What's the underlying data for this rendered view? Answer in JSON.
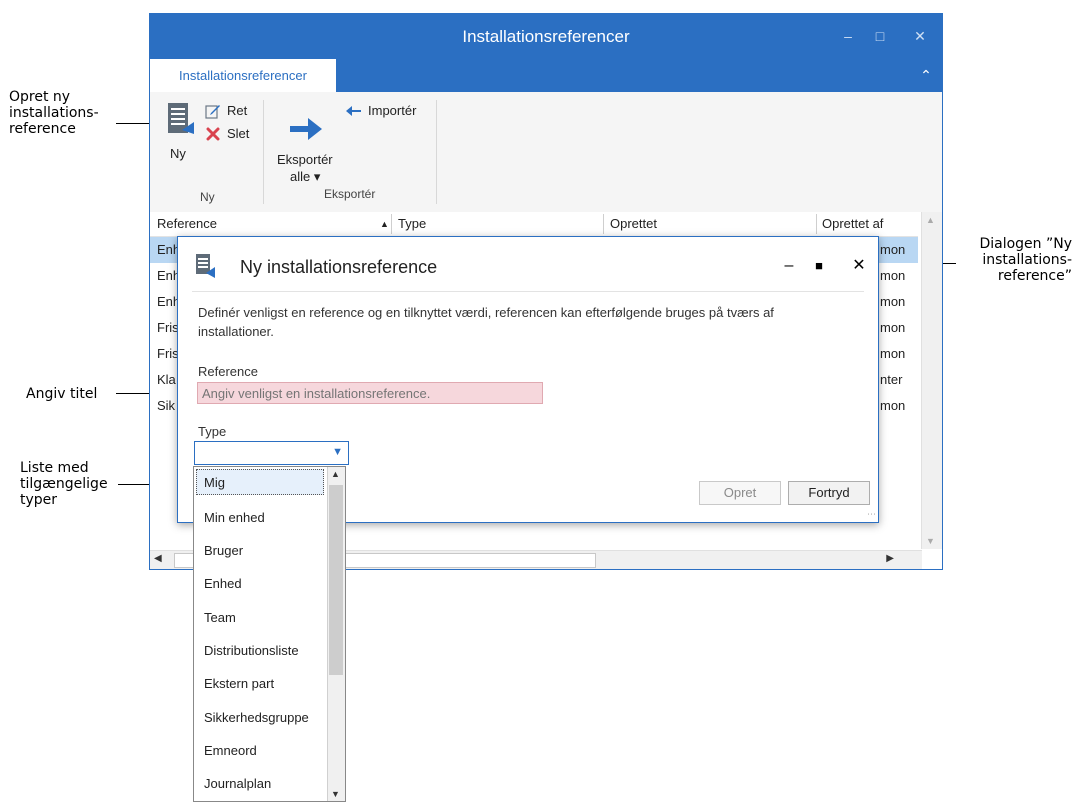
{
  "annotations": {
    "create_ref": "Opret ny installations-reference",
    "dialog_note": "Dialogen ”Ny installations-reference”",
    "title_note": "Angiv titel",
    "types_note": "Liste med tilgængelige typer"
  },
  "window": {
    "title": "Installationsreferencer",
    "minimize": "–",
    "maximize": "□",
    "close": "✕"
  },
  "ribbon": {
    "tab": "Installationsreferencer",
    "collapse": "⌃",
    "new_label": "Ny",
    "edit_label": "Ret",
    "delete_label": "Slet",
    "group_new": "Ny",
    "export_all_line1": "Eksportér",
    "export_all_line2": "alle ▾",
    "import_label": "Importér",
    "group_export": "Eksportér"
  },
  "list": {
    "columns": [
      "Reference",
      "Type",
      "Oprettet",
      "Oprettet af"
    ],
    "sort_indicator": "▲",
    "rows": [
      {
        "ref": "Enh",
        "by": "mon"
      },
      {
        "ref": "Enh",
        "by": "mon"
      },
      {
        "ref": "Enh",
        "by": "mon"
      },
      {
        "ref": "Fris",
        "by": "mon"
      },
      {
        "ref": "Fris",
        "by": "mon"
      },
      {
        "ref": "Kla",
        "by": "nter"
      },
      {
        "ref": "Sik",
        "by": "mon"
      }
    ]
  },
  "dialog": {
    "title": "Ny installationsreference",
    "minimize": "–",
    "maximize": "■",
    "close": "✕",
    "description": "Definér venligst en reference og en tilknyttet værdi, referencen kan efterfølgende bruges på tværs af installationer.",
    "reference_label": "Reference",
    "reference_placeholder": "Angiv venligst en installationsreference.",
    "type_label": "Type",
    "type_value": "",
    "create_button": "Opret",
    "cancel_button": "Fortryd"
  },
  "dropdown": {
    "selected_index": 0,
    "items": [
      "Mig",
      "Min enhed",
      "Bruger",
      "Enhed",
      "Team",
      "Distributionsliste",
      "Ekstern part",
      "Sikkerhedsgruppe",
      "Emneord",
      "Journalplan"
    ]
  },
  "colors": {
    "accent": "#2b6fc2",
    "error_fill": "#f6d7dc"
  },
  "icons": [
    "document-stack-icon",
    "edit-icon",
    "delete-icon",
    "export-arrow-icon",
    "import-arrow-icon"
  ]
}
